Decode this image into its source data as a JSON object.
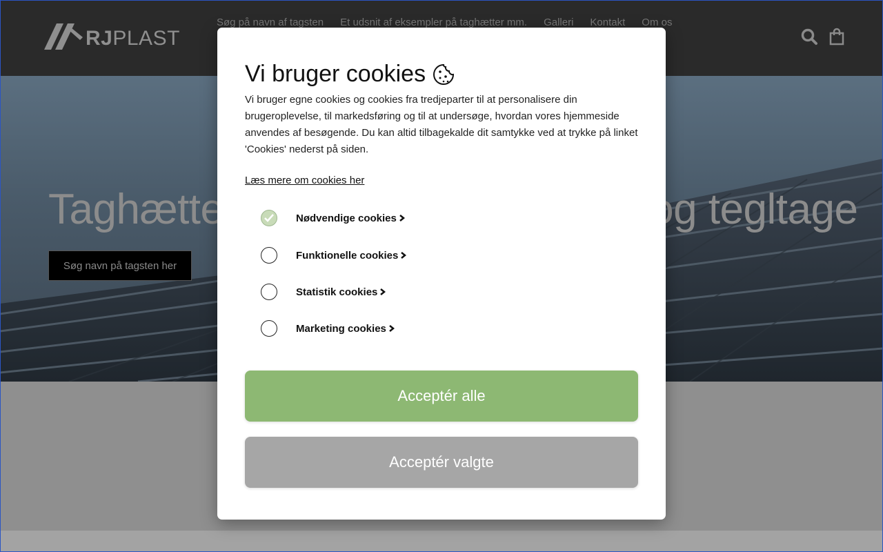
{
  "header": {
    "logo_bold": "RJ",
    "logo_light": "PLAST",
    "nav": [
      "Søg på navn af tagsten",
      "Et udsnit af eksempler på taghætter mm.",
      "Galleri",
      "Kontakt",
      "Om os"
    ]
  },
  "hero": {
    "title": "Taghætter og tilbehør til tagsten og tegltage",
    "button": "Søg navn på tagsten her"
  },
  "cookie_modal": {
    "title": "Vi bruger cookies",
    "body": "Vi bruger egne cookies og cookies fra tredjeparter til at personalisere din brugeroplevelse, til markedsføring og til at undersøge, hvordan vores hjemmeside anvendes af besøgende. Du kan altid tilbagekalde dit samtykke ved at trykke på linket 'Cookies' nederst på siden.",
    "link": "Læs mere om cookies her",
    "options": [
      {
        "label": "Nødvendige cookies",
        "checked": true
      },
      {
        "label": "Funktionelle cookies",
        "checked": false
      },
      {
        "label": "Statistik cookies",
        "checked": false
      },
      {
        "label": "Marketing cookies",
        "checked": false
      }
    ],
    "accept_all": "Acceptér alle",
    "accept_selected": "Acceptér valgte"
  },
  "colors": {
    "accept_all": "#8db873",
    "accept_selected": "#a6a6a6",
    "header_bg": "#2a2a2a"
  }
}
